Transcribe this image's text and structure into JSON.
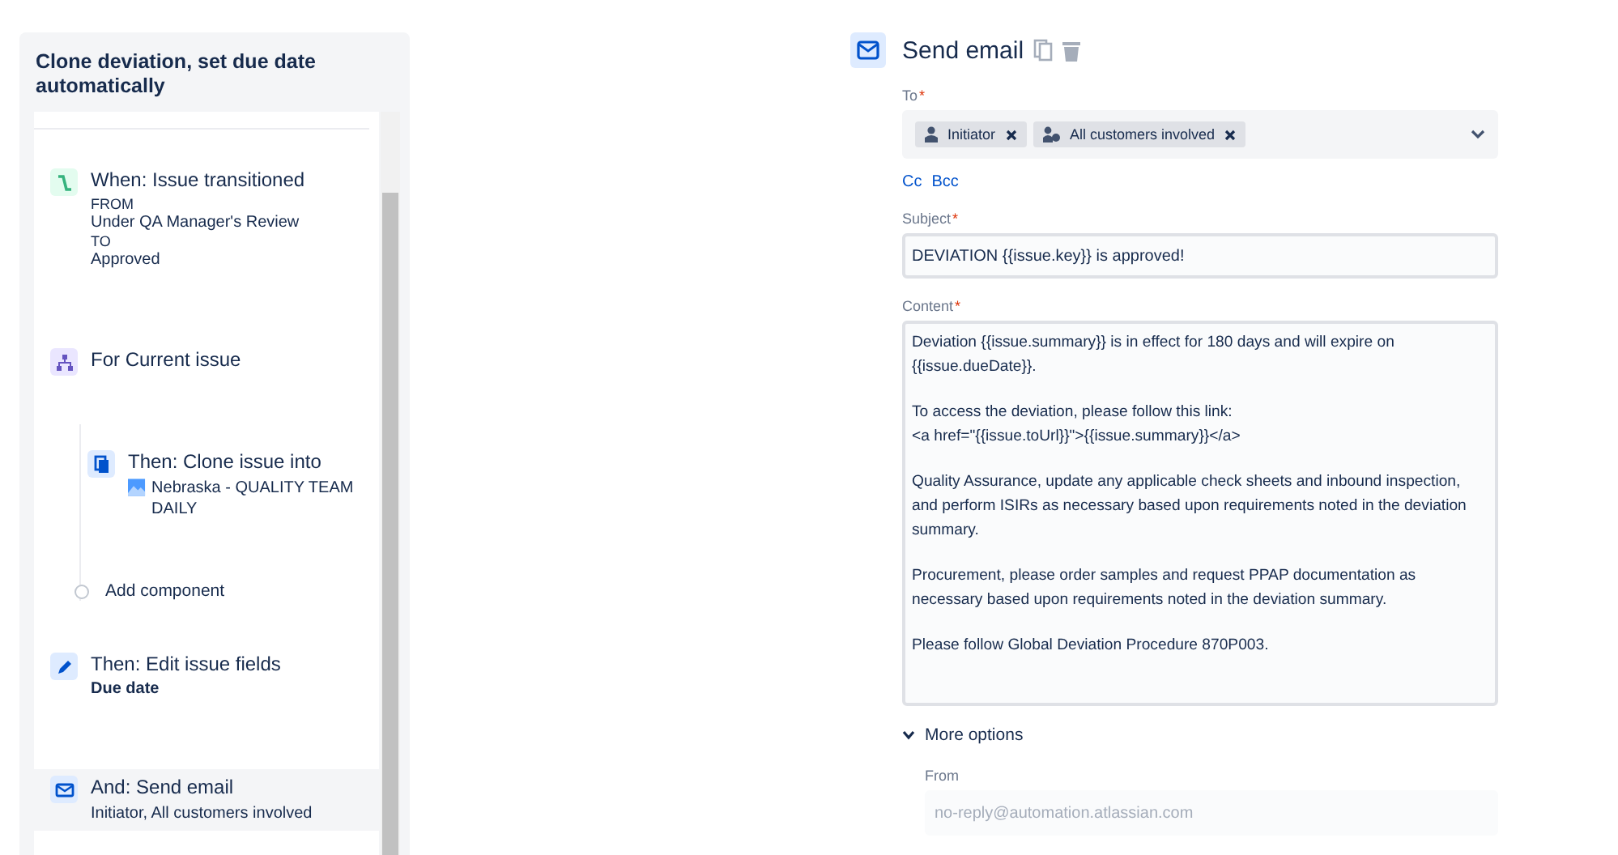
{
  "rule": {
    "title": "Clone deviation, set due date automatically",
    "steps": [
      {
        "kind": "trigger",
        "title": "When: Issue transitioned",
        "details": [
          {
            "kind": "caps",
            "text": "FROM"
          },
          {
            "kind": "plain",
            "text": "Under QA Manager's Review"
          },
          {
            "kind": "caps",
            "text": "TO"
          },
          {
            "kind": "plain",
            "text": "Approved"
          }
        ],
        "selected": false
      },
      {
        "kind": "branch",
        "title": "For Current issue",
        "selected": false,
        "children": [
          {
            "kind": "clone",
            "title": "Then: Clone issue into",
            "project": "Nebraska - QUALITY TEAM DAILY"
          },
          {
            "kind": "add",
            "title": "Add component"
          }
        ]
      },
      {
        "kind": "edit",
        "title": "Then: Edit issue fields",
        "details": [
          {
            "kind": "bold",
            "text": "Due date"
          }
        ],
        "selected": false
      },
      {
        "kind": "email",
        "title": "And: Send email",
        "details": [
          {
            "kind": "plain",
            "text": "Initiator, All customers involved"
          }
        ],
        "selected": true
      }
    ]
  },
  "editor": {
    "title": "Send email",
    "to": {
      "label": "To",
      "required_mark": "*",
      "recipients": [
        {
          "kind": "user",
          "label": "Initiator"
        },
        {
          "kind": "group",
          "label": "All customers involved"
        }
      ]
    },
    "cc_links": [
      "Cc",
      "Bcc"
    ],
    "subject": {
      "label": "Subject",
      "required_mark": "*",
      "value": "DEVIATION {{issue.key}} is approved!"
    },
    "content": {
      "label": "Content",
      "required_mark": "*",
      "paragraphs": [
        "Deviation {{issue.summary}} is in effect for 180 days and will expire on {{issue.dueDate}}.",
        "To access the deviation, please follow this link:\n<a href=\"{{issue.toUrl}}\">{{issue.summary}}</a>",
        "Quality Assurance, update any applicable check sheets and inbound inspection, and perform ISIRs as necessary based upon requirements noted in the deviation summary.",
        "Procurement, please order samples and request PPAP documentation as necessary based upon requirements noted in the deviation summary.",
        "Please follow Global Deviation Procedure 870P003."
      ]
    },
    "more_options": {
      "label": "More options",
      "expanded": true,
      "from": {
        "label": "From",
        "placeholder": "no-reply@automation.atlassian.com"
      }
    }
  }
}
